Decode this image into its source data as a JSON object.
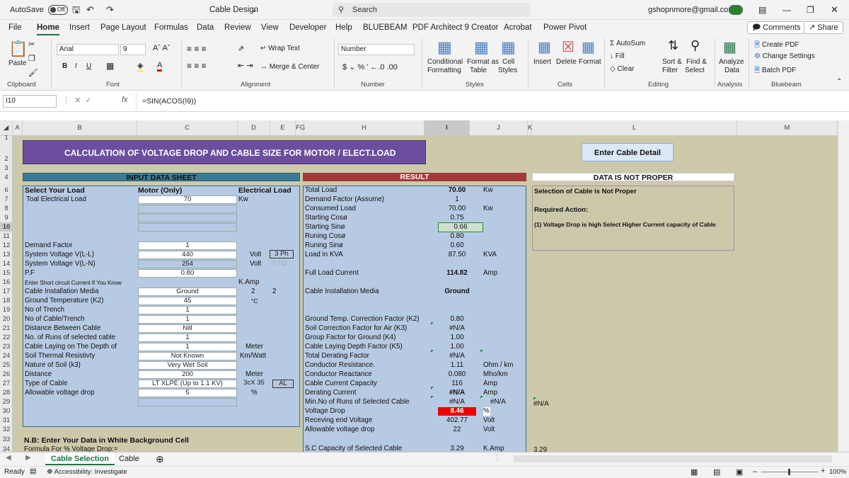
{
  "window": {
    "autosave": "AutoSave",
    "autosave_state": "Off",
    "title": "Cable Design",
    "search_placeholder": "Search",
    "account": "gshopnmore@gmail.com"
  },
  "menu": [
    "File",
    "Home",
    "Insert",
    "Page Layout",
    "Formulas",
    "Data",
    "Review",
    "View",
    "Developer",
    "Help",
    "BLUEBEAM",
    "PDF Architect 9 Creator",
    "Acrobat",
    "Power Pivot"
  ],
  "menu_right": {
    "comments": "Comments",
    "share": "Share"
  },
  "ribbon": {
    "paste": "Paste",
    "font_name": "Arial",
    "font_size": "9",
    "wrap_text": "Wrap Text",
    "merge_center": "Merge & Center",
    "number_format": "Number",
    "conditional": "Conditional",
    "formatting": "Formatting",
    "format_as": "Format as",
    "table": "Table",
    "cell": "Cell",
    "styles_btn": "Styles",
    "insert": "Insert",
    "delete": "Delete",
    "format": "Format",
    "autosum": "AutoSum",
    "fill": "Fill",
    "clear": "Clear",
    "sort_filter_1": "Sort &",
    "sort_filter_2": "Filter",
    "find_select_1": "Find &",
    "find_select_2": "Select",
    "analyze_1": "Analyze",
    "analyze_2": "Data",
    "create_pdf": "Create PDF",
    "change_settings": "Change Settings",
    "batch_pdf": "Batch PDF",
    "groups": [
      "Clipboard",
      "Font",
      "Alignment",
      "Number",
      "Styles",
      "Cells",
      "Editing",
      "Analysis",
      "Bluebeam"
    ]
  },
  "formula_bar": {
    "name_box": "I10",
    "fx": "fx",
    "formula": "=SIN(ACOS(I9))"
  },
  "columns": [
    "A",
    "B",
    "C",
    "D",
    "E",
    "FG",
    "H",
    "I",
    "J",
    "K",
    "L",
    "M"
  ],
  "rows": [
    "1",
    "2",
    "3",
    "4",
    "6",
    "7",
    "8",
    "9",
    "10",
    "11",
    "12",
    "13",
    "14",
    "15",
    "16",
    "17",
    "18",
    "19",
    "20",
    "21",
    "22",
    "23",
    "24",
    "25",
    "26",
    "27",
    "28",
    "29",
    "30",
    "31",
    "32",
    "33",
    "34"
  ],
  "sheet": {
    "banner": "CALCULATION OF VOLTAGE DROP AND CABLE SIZE FOR MOTOR / ELECT.LOAD",
    "detail_button": "Enter Cable Detail",
    "input_header": "INPUT DATA SHEET",
    "result_header": "RESULT",
    "msg_header": "DATA IS NOT PROPER",
    "input": {
      "select_load": "Select Your Load",
      "motor_only": "Motor (Only)",
      "elec_load": "Electrical Load",
      "total_load_label": "Toal Electrical Load",
      "total_load": "70",
      "kw": "Kw",
      "demand_factor": "Demand Factor",
      "demand_factor_val": "1",
      "sys_ll": "System Voltage V(L-L)",
      "sys_ll_val": "440",
      "volt": "Volt",
      "phase": "3 Ph",
      "sys_ln": "System Voltage V(L-N)",
      "sys_ln_val": "254",
      "sqrt3": "1.732",
      "pf": "P.F",
      "pf_val": "0.80",
      "short_circuit": "Enter Short circuit Current If You Know",
      "kamp": "K.Amp",
      "install_media": "Cable Installation Media",
      "install_media_val": "Ground",
      "two_a": "2",
      "two_b": "2",
      "ground_temp": "Ground Temperature (K2)",
      "ground_temp_val": "45",
      "deg": "°C",
      "trench": "No of Trench",
      "trench_val": "1",
      "cable_trench": "No of Cable/Trench",
      "cable_trench_val": "1",
      "distance_between": "Distance Between Cable",
      "distance_between_val": "Nill",
      "runs": "No. of Runs of selected cable",
      "runs_val": "1",
      "depth": "Cable Laying on The Depth of",
      "depth_val": "1",
      "meter": "Meter",
      "thermal": "Soil Thermal Resistivty",
      "thermal_val": "Not Known",
      "km_watt": "Km/Watt",
      "nature": "Nature of Soil (k3)",
      "nature_val": "Very Wet Soil",
      "distance": "Distance",
      "distance_val": "200",
      "meter2": "Meter",
      "type": "Type of Cable",
      "type_val": "LT XLPE (Up to 1.1 KV)",
      "size": "3cX 35",
      "material": "AL",
      "allow_drop": "Allowable voltage drop",
      "allow_drop_val": "5",
      "pct": "%"
    },
    "result": {
      "total_load": "Total Load",
      "total_load_val": "70.00",
      "kw": "Kw",
      "demand_factor": "Demand Factor (Assume)",
      "demand_factor_val": "1",
      "consumed": "Consumed Load",
      "consumed_val": "70.00",
      "kw2": "Kw",
      "start_cos": "Starting Cosø",
      "start_cos_val": "0.75",
      "start_sin": "Starting Sinø",
      "start_sin_val": "0.66",
      "run_cos": "Runing Cosø",
      "run_cos_val": "0.80",
      "run_sin": "Runing Sinø",
      "run_sin_val": "0.60",
      "kva": "Load in KVA",
      "kva_val": "87.50",
      "kva_unit": "KVA",
      "flc": "Full Load Current",
      "flc_val": "114.82",
      "amp": "Amp",
      "media": "Cable Installation Media",
      "media_val": "Ground",
      "k2": "Ground Temp. Correction Factor (K2)",
      "k2_val": "0.80",
      "k3": "Soil Correction Factor for Air (K3)",
      "k3_val": "#N/A",
      "k4": "Group Factor for Ground (K4)",
      "k4_val": "1.00",
      "k5": "Cable Laying Depth Factor (K5)",
      "k5_val": "1.00",
      "total_derating": "Total Derating Factor",
      "total_derating_val": "#N/A",
      "resistance": "Conductor Resistance.",
      "resistance_val": "1.11",
      "ohm": "Ohm / km",
      "reactance": "Conductor Reactance",
      "reactance_val": "0.080",
      "mho": "Mho/km",
      "capacity": "Cable Current Capacity",
      "capacity_val": "116",
      "amp2": "Amp",
      "derating_current": "Derating Current",
      "derating_current_val": "#N/A",
      "amp3": "Amp",
      "min_runs": "Min.No of Runs of Selected Cable",
      "min_runs_val": "#N/A",
      "min_runs_j": "#N/A",
      "min_runs_l": "#N/A",
      "vdrop": "Voltage Drop",
      "vdrop_val": "8.46",
      "pct": "%",
      "receiving": "Receving end Voltage",
      "receiving_val": "402.77",
      "volt": "Volt",
      "allow": "Allowable voltage drop",
      "allow_val": "22",
      "volt2": "Volt",
      "sc_capacity": "S.C Capacity of Selected Cable",
      "sc_capacity_val": "3.29",
      "kamp": "K.Amp",
      "sc_l": "3.29"
    },
    "message": {
      "line1": "Selection of Cable is Not Proper",
      "line2": "Required Action:",
      "line3": "(1) Voltage Drop is high Select Higher Current capacity of Cable"
    },
    "note": "N.B: Enter Your Data in White Background Cell",
    "formula_note": "Formula For % Voltage Drop:="
  },
  "tabs": [
    "Cable Selection",
    "Cable"
  ],
  "status": {
    "ready": "Ready",
    "accessibility": "Accessibility: Investigate",
    "zoom": "100%"
  },
  "colors": {
    "accent": "#217346",
    "banner": "#6b4f9e",
    "panel": "#b7cae3",
    "sheet_bg": "#cdc9ab",
    "input_header": "#3a7a96",
    "result_header": "#a33a3a",
    "alert": "#ee0000"
  }
}
